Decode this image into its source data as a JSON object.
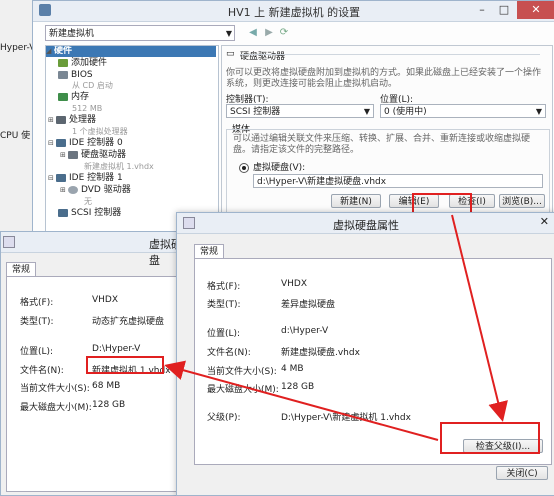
{
  "background": {
    "hyperv_label": "Hyper-V 管",
    "cpu_label": "CPU 使"
  },
  "settings": {
    "title": "HV1 上 新建虚拟机 的设置",
    "vm_select": "新建虚拟机",
    "tree": [
      {
        "label": "硬件",
        "head": true
      },
      {
        "label": "添加硬件"
      },
      {
        "label": "BIOS"
      },
      {
        "label": "从 CD 启动",
        "sub": true
      },
      {
        "label": "内存"
      },
      {
        "label": "512 MB",
        "sub": true
      },
      {
        "label": "处理器"
      },
      {
        "label": "1 个虚拟处理器",
        "sub": true
      },
      {
        "label": "IDE 控制器 0"
      },
      {
        "label": "硬盘驱动器"
      },
      {
        "label": "新建虚拟机 1.vhdx",
        "sub": true
      },
      {
        "label": "IDE 控制器 1"
      },
      {
        "label": "DVD 驱动器"
      },
      {
        "label": "无",
        "sub": true
      },
      {
        "label": "SCSI 控制器"
      }
    ],
    "panel": {
      "heading": "硬盘驱动器",
      "description": "你可以更改将虚拟硬盘附加到虚拟机的方式。如果此磁盘上已经安装了一个操作系统，则更改连接可能会阻止虚拟机启动。",
      "controller_label": "控制器(T):",
      "controller_value": "SCSI 控制器",
      "location_label": "位置(L):",
      "location_value": "0 (使用中)",
      "media_label": "媒体",
      "media_desc": "可以通过编辑关联文件来压缩、转换、扩展、合并、重新连接或收缩虚拟硬盘。请指定该文件的完整路径。",
      "vhd_label": "虚拟硬盘(V):",
      "vhd_path": "d:\\Hyper-V\\新建虚拟硬盘.vhdx",
      "btn_new": "新建(N)",
      "btn_edit": "编辑(E)",
      "btn_inspect": "检查(I)",
      "btn_browse": "浏览(B)..."
    }
  },
  "dlg_left": {
    "title": "虚拟硬盘",
    "tab": "常规",
    "rows": [
      {
        "label": "格式(F):",
        "value": "VHDX"
      },
      {
        "label": "类型(T):",
        "value": "动态扩充虚拟硬盘"
      },
      {
        "label": "位置(L):",
        "value": "D:\\Hyper-V"
      },
      {
        "label": "文件名(N):",
        "value": "新建虚拟机 1.vhdx"
      },
      {
        "label": "当前文件大小(S):",
        "value": "68 MB"
      },
      {
        "label": "最大磁盘大小(M):",
        "value": "128 GB"
      }
    ]
  },
  "dlg_right": {
    "title": "虚拟硬盘属性",
    "tab": "常规",
    "rows": [
      {
        "label": "格式(F):",
        "value": "VHDX"
      },
      {
        "label": "类型(T):",
        "value": "差异虚拟硬盘"
      },
      {
        "label": "位置(L):",
        "value": "d:\\Hyper-V"
      },
      {
        "label": "文件名(N):",
        "value": "新建虚拟硬盘.vhdx"
      },
      {
        "label": "当前文件大小(S):",
        "value": "4 MB"
      },
      {
        "label": "最大磁盘大小(M):",
        "value": "128 GB"
      },
      {
        "label": "父级(P):",
        "value": "D:\\Hyper-V\\新建虚拟机 1.vhdx"
      }
    ],
    "btn_inspect_parent": "检查父级(I)...",
    "btn_close": "关闭(C)"
  },
  "colors": {
    "highlight": "#e02020",
    "title_blue": "#3c78b4"
  }
}
